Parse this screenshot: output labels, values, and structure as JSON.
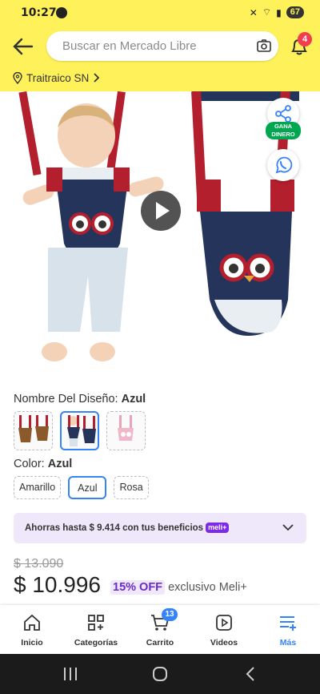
{
  "status_bar": {
    "time": "10:27",
    "battery": "67"
  },
  "header": {
    "search_placeholder": "Buscar en Mercado Libre",
    "notification_count": "4",
    "location": "Traitraico SN"
  },
  "gallery": {
    "gana_label_line1": "GANA",
    "gana_label_line2": "DINERO"
  },
  "variations": {
    "design_label": "Nombre Del Diseño:",
    "design_value": "Azul",
    "color_label": "Color:",
    "color_value": "Azul",
    "color_options": [
      "Amarillo",
      "Azul",
      "Rosa"
    ]
  },
  "benefit": {
    "text": "Ahorras hasta $ 9.414 con tus beneficios",
    "badge": "meli+"
  },
  "pricing": {
    "old_price": "$ 13.090",
    "price": "$ 10.996",
    "discount": "15% OFF",
    "exclusive": "exclusivo Meli+"
  },
  "bottom_nav": {
    "items": [
      "Inicio",
      "Categorías",
      "Carrito",
      "Videos",
      "Más"
    ],
    "cart_count": "13"
  },
  "colors": {
    "brand_yellow": "#fff159",
    "accent_blue": "#3483fa",
    "meli_purple": "#7d2ae8",
    "harness_navy": "#25345a",
    "harness_red": "#b41f2e"
  }
}
